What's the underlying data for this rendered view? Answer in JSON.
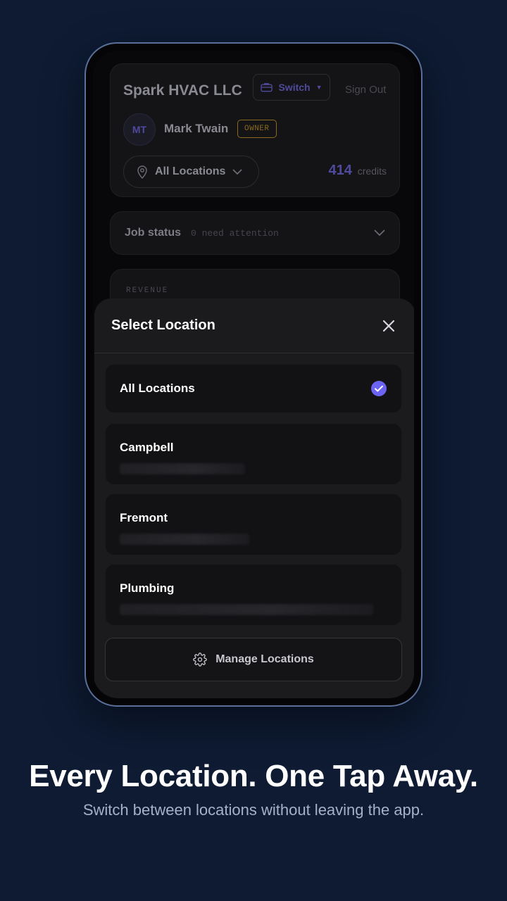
{
  "header": {
    "company": "Spark HVAC LLC",
    "switch_label": "Switch",
    "signout_label": "Sign Out",
    "avatar_initials": "MT",
    "user_name": "Mark Twain",
    "role_badge": "OWNER",
    "location_filter": "All Locations",
    "credits_value": "414",
    "credits_label": "credits"
  },
  "job_status": {
    "title": "Job status",
    "subtitle": "0 need attention"
  },
  "revenue": {
    "label": "REVENUE"
  },
  "sheet": {
    "title": "Select Location",
    "locations": [
      {
        "name": "All Locations",
        "selected": true
      },
      {
        "name": "Campbell",
        "selected": false
      },
      {
        "name": "Fremont",
        "selected": false
      },
      {
        "name": "Plumbing",
        "selected": false
      }
    ],
    "manage_label": "Manage Locations"
  },
  "promo": {
    "headline": "Every Location. One Tap Away.",
    "subline": "Switch between locations without leaving the app."
  },
  "colors": {
    "background": "#0e1b33",
    "accent": "#6b63f2",
    "owner_badge": "#8a6a1c"
  }
}
